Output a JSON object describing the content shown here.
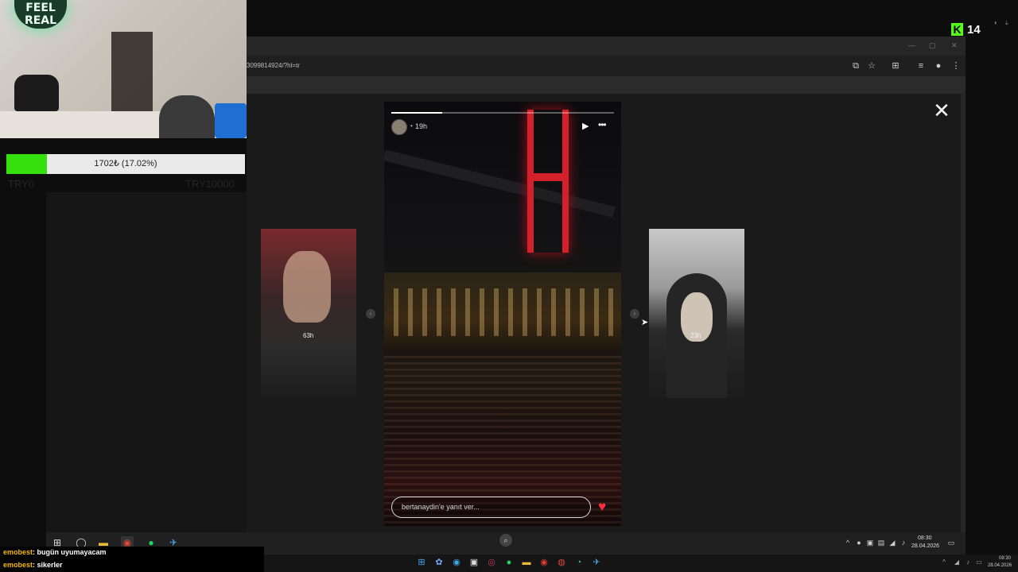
{
  "overlay": {
    "webcam_sign": "FEEL REAL",
    "donation": {
      "label": "1702₺ (17.02%)",
      "progress_percent": 17.02,
      "min": "TRY0",
      "max": "TRY10000",
      "fill_color": "#35e10d"
    },
    "kick_logo": "K",
    "viewer_count": "14",
    "kick_color": "#53fc18"
  },
  "browser": {
    "url": "3099814924/?hl=tr"
  },
  "story": {
    "time": "19h",
    "dot": "•",
    "reply_placeholder": "bertanaydin'e yanıt ver...",
    "play_icon": "play-icon",
    "more_icon": "more-icon",
    "heart_icon": "heart-icon",
    "close_icon": "close-icon",
    "progress_fraction": 0.23,
    "prev_story_time": "63h",
    "next_story_time": "23h",
    "heart_color": "#ff2f40"
  },
  "inner_taskbar": {
    "time": "08:30",
    "date": "28.04.2026"
  },
  "chat": [
    {
      "user": "emobest",
      "message": ": bugün uyumayacam"
    },
    {
      "user": "emobest",
      "message": ": sikerler"
    }
  ],
  "outer_taskbar": {
    "time": "08:30",
    "date": "28.04.2026"
  }
}
